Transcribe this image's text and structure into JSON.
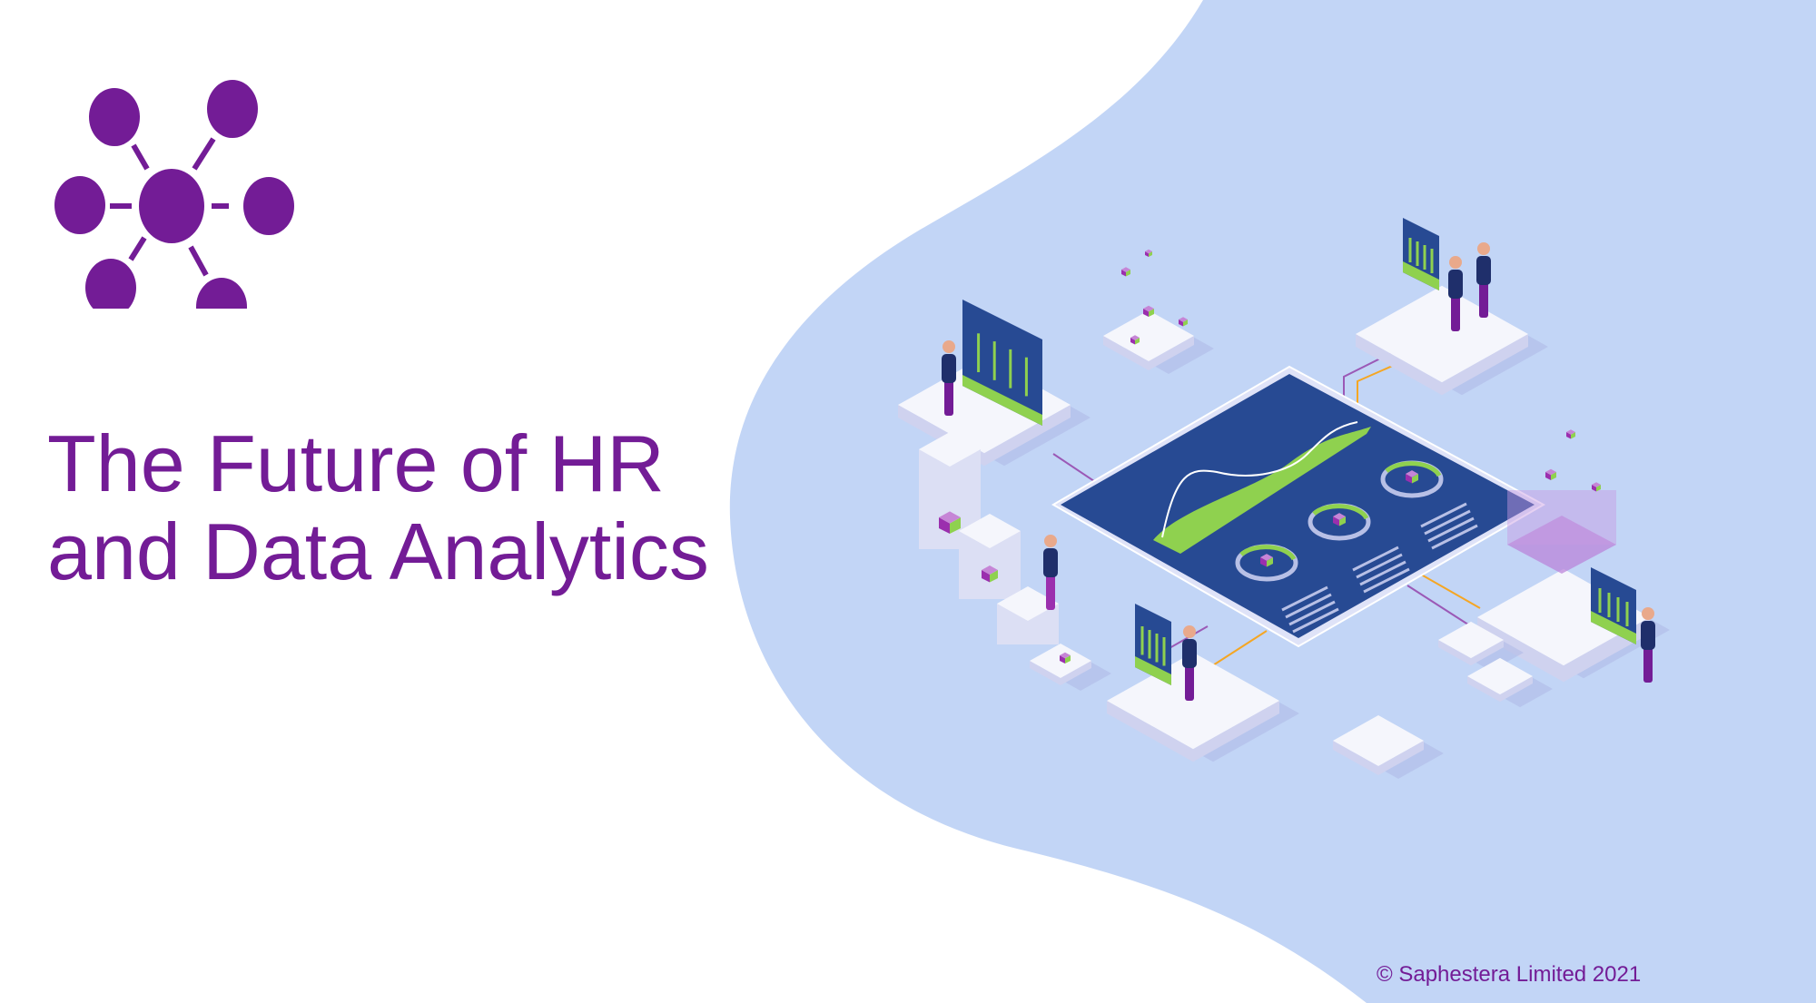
{
  "slide": {
    "title_line1": "The Future of HR",
    "title_line2": "and Data Analytics",
    "copyright": "© Saphestera Limited 2021"
  },
  "colors": {
    "brand_purple": "#731c96",
    "background_blob": "#c2d5f6",
    "dashboard_blue": "#274a93",
    "accent_green": "#8fd14f",
    "accent_orange": "#f5a623"
  },
  "icons": {
    "logo": "network-molecule-logo",
    "illustration": "isometric-data-analytics-illustration"
  }
}
